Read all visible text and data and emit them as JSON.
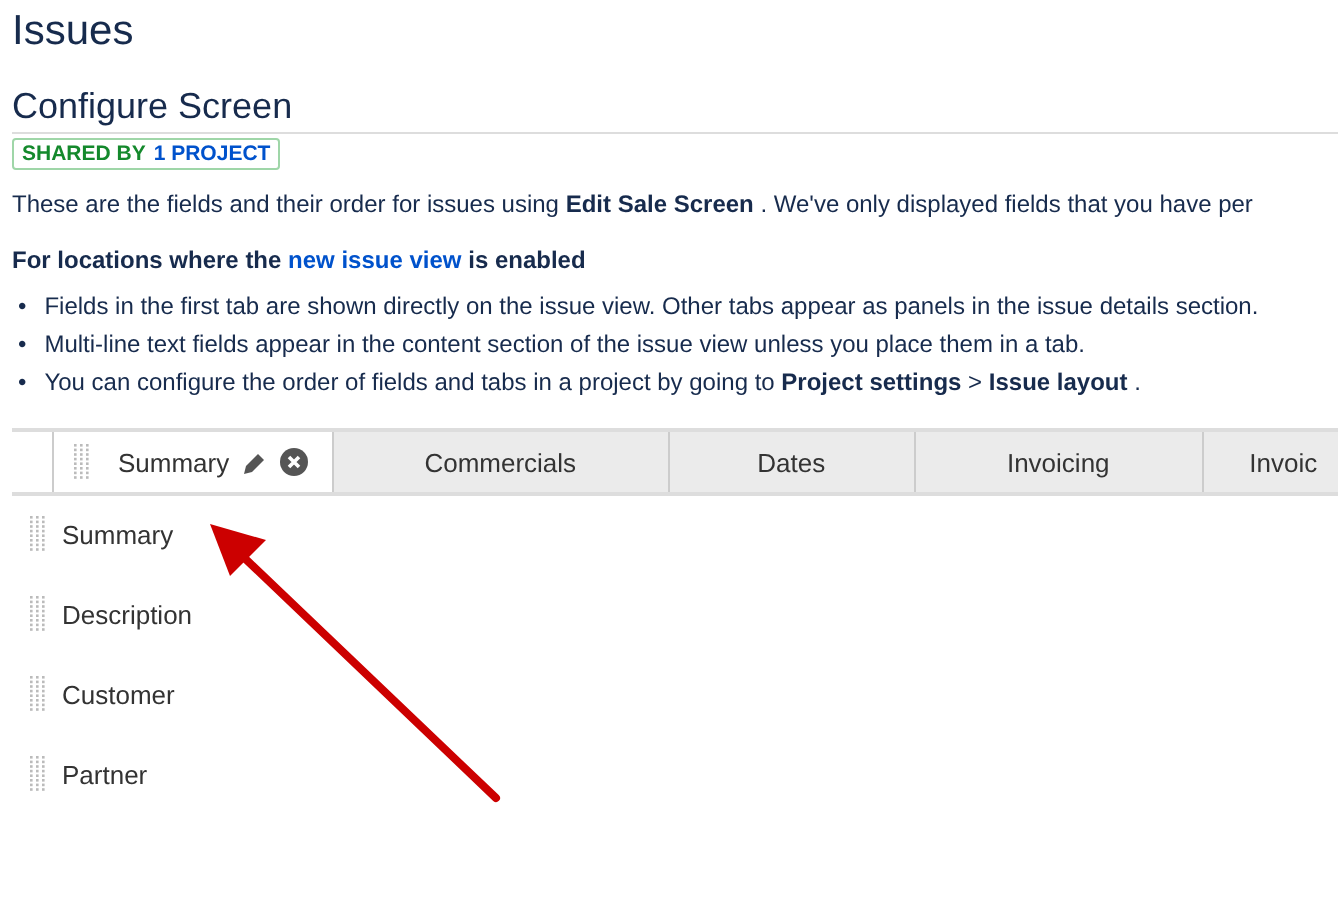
{
  "page_title": "Issues",
  "screen": {
    "title": "Configure Screen",
    "badge": {
      "label": "SHARED BY",
      "link": "1 PROJECT"
    },
    "description": "These are the fields and their order for issues using **Edit Sale Screen** . We've only displayed fields that you have per",
    "notice": {
      "text_before": "For locations where the",
      "link": "new issue view",
      "text_after": "is enabled"
    },
    "bullets": [
      {
        "marker": "•",
        "text": "Fields in the first tab are shown directly on the issue view. Other tabs appear as panels in the issue details section."
      },
      {
        "marker": "•",
        "text": "Multi-line text fields appear in the content section of the issue view unless you place them in a tab."
      },
      {
        "marker": "•",
        "text": "You can configure the order of fields and tabs in a project by going to **Project settings** > **Issue layout** ."
      }
    ],
    "tabs": [
      {
        "label": "Summary",
        "selected": true
      },
      {
        "label": "Commercials",
        "selected": false
      },
      {
        "label": "Dates",
        "selected": false
      },
      {
        "label": "Invoicing",
        "selected": false
      },
      {
        "label": "Invoic",
        "selected": false
      }
    ],
    "fields": [
      "Summary",
      "Description",
      "Customer",
      "Partner"
    ]
  }
}
